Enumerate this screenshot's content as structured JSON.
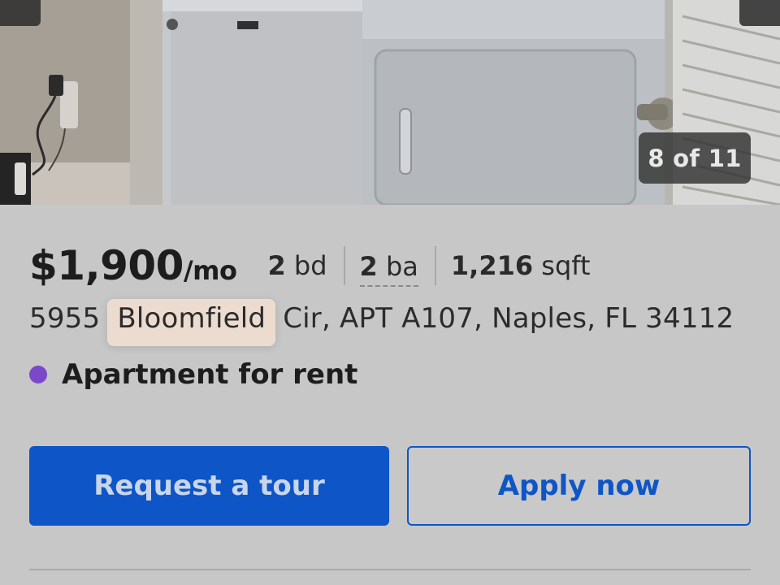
{
  "gallery": {
    "counter": "8 of 11",
    "photo_subject": "laundry-washer-dryer-photo"
  },
  "listing": {
    "price": "$1,900",
    "price_unit": "/mo",
    "beds_value": "2",
    "beds_unit": "bd",
    "baths_value": "2",
    "baths_unit": "ba",
    "sqft_value": "1,216",
    "sqft_unit": "sqft",
    "address_prefix": "5955 ",
    "address_highlight": "Bloomfield",
    "address_suffix": " Cir, APT A107, Naples, FL 34112",
    "status_label": "Apartment for rent",
    "status_color": "#7b49c8"
  },
  "actions": {
    "tour_label": "Request a tour",
    "apply_label": "Apply now",
    "primary_color": "#0e55c7"
  }
}
